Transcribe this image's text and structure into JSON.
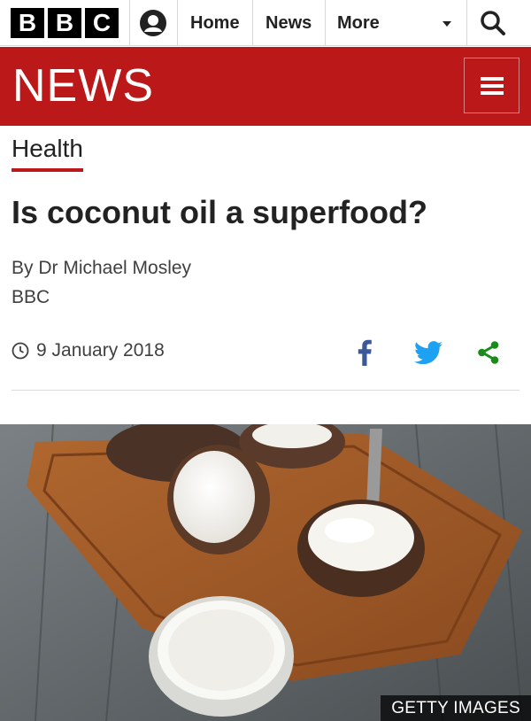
{
  "header": {
    "logo_letters": [
      "B",
      "B",
      "C"
    ],
    "nav": {
      "home": "Home",
      "news": "News",
      "more": "More"
    },
    "icons": {
      "account": "account-icon",
      "search": "search-icon",
      "more_arrow": "chevron-down-icon"
    }
  },
  "banner": {
    "title": "NEWS",
    "menu_icon": "hamburger-menu-icon",
    "color": "#bb1919"
  },
  "article": {
    "section": "Health",
    "headline": "Is coconut oil a superfood?",
    "byline": "By Dr Michael Mosley",
    "organisation": "BBC",
    "date": "9 January 2018",
    "share": [
      {
        "icon": "facebook-icon",
        "color": "#3b5998"
      },
      {
        "icon": "twitter-icon",
        "color": "#1da1f2"
      },
      {
        "icon": "share-icon",
        "color": "#1a8a1a"
      }
    ]
  },
  "image": {
    "credit": "GETTY IMAGES"
  },
  "colors": {
    "accent": "#bb1919",
    "text": "#222222"
  }
}
